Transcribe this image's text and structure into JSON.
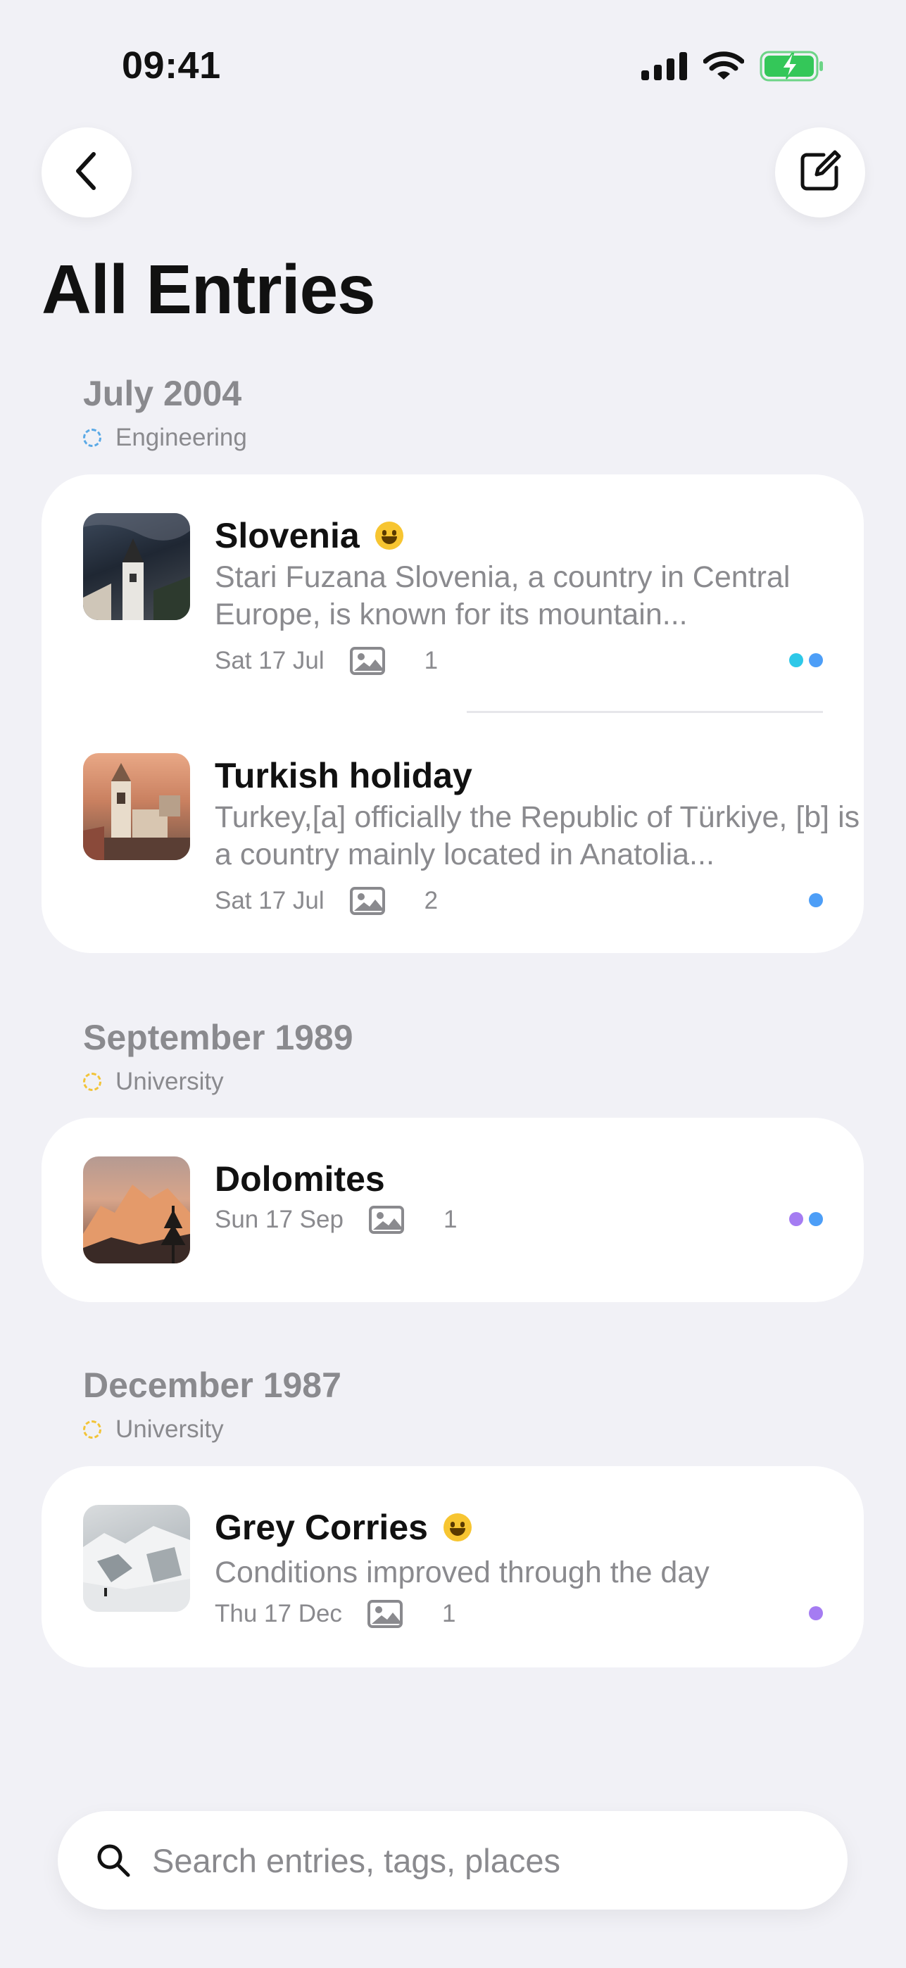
{
  "status": {
    "time": "09:41"
  },
  "header": {
    "title": "All Entries"
  },
  "groups": [
    {
      "month": "July 2004",
      "tag": "Engineering",
      "tag_color": "#5AA9E6",
      "entries": [
        {
          "title": "Slovenia",
          "has_emoji": true,
          "snippet": "Stari Fuzana   Slovenia, a country in Central Europe, is known for its mountain...",
          "date": "Sat 17 Jul",
          "photo_count": "1",
          "dots": [
            "#2DC8E8",
            "#4D9EF7"
          ]
        },
        {
          "title": "Turkish holiday",
          "has_emoji": false,
          "snippet": "Turkey,[a] officially the Republic of Türkiye, [b] is a country mainly located in Anatolia...",
          "date": "Sat 17 Jul",
          "photo_count": "2",
          "dots": [
            "#4D9EF7"
          ]
        }
      ]
    },
    {
      "month": "September 1989",
      "tag": "University",
      "tag_color": "#F2C438",
      "entries": [
        {
          "title": "Dolomites",
          "has_emoji": false,
          "snippet": "",
          "date": "Sun 17 Sep",
          "photo_count": "1",
          "dots": [
            "#A57CF2",
            "#4D9EF7"
          ]
        }
      ]
    },
    {
      "month": "December 1987",
      "tag": "University",
      "tag_color": "#F2C438",
      "entries": [
        {
          "title": "Grey Corries",
          "has_emoji": true,
          "snippet": "Conditions improved through the day",
          "date": "Thu 17 Dec",
          "photo_count": "1",
          "dots": [
            "#A57CF2"
          ]
        }
      ]
    }
  ],
  "search": {
    "placeholder": "Search entries, tags, places"
  },
  "icons": {
    "back": "chevron-left-icon",
    "compose": "compose-icon",
    "photo": "photo-icon",
    "search": "search-icon",
    "signal": "signal-icon",
    "wifi": "wifi-icon",
    "battery": "battery-charging-icon"
  },
  "colors": {
    "background": "#F1F1F6",
    "card": "#FFFFFF",
    "secondary_text": "#8A8A8E",
    "battery": "#34C759"
  }
}
